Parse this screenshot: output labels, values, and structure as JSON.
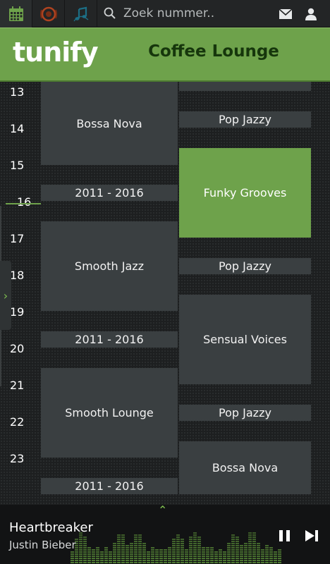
{
  "search": {
    "placeholder": "Zoek nummer.."
  },
  "header": {
    "logo": "tunify",
    "channel": "Coffee Lounge"
  },
  "hours": [
    "13",
    "14",
    "15",
    "16",
    "17",
    "18",
    "19",
    "20",
    "21",
    "22",
    "23"
  ],
  "schedule": {
    "left": [
      {
        "label": ""
      },
      {
        "label": "Bossa Nova"
      },
      {
        "label": "2011 - 2016"
      },
      {
        "label": "Smooth Jazz"
      },
      {
        "label": "2011 - 2016"
      },
      {
        "label": "Smooth Lounge"
      },
      {
        "label": "2011 - 2016"
      }
    ],
    "right": [
      {
        "label": ""
      },
      {
        "label": "Pop Jazzy"
      },
      {
        "label": "Funky Grooves"
      },
      {
        "label": "Pop Jazzy"
      },
      {
        "label": "Sensual Voices"
      },
      {
        "label": "Pop Jazzy"
      },
      {
        "label": "Bossa Nova"
      }
    ]
  },
  "player": {
    "title": "Heartbreaker",
    "artist": "Justin Bieber"
  },
  "colors": {
    "accent": "#6ea24b",
    "block": "#3a3f41",
    "header_text": "#16360c"
  },
  "icons": [
    "calendar-icon",
    "radio-icon",
    "music-note-icon",
    "search-icon",
    "mail-icon",
    "user-icon",
    "chevron-right-icon",
    "chevron-up-icon",
    "pause-icon",
    "skip-next-icon"
  ]
}
